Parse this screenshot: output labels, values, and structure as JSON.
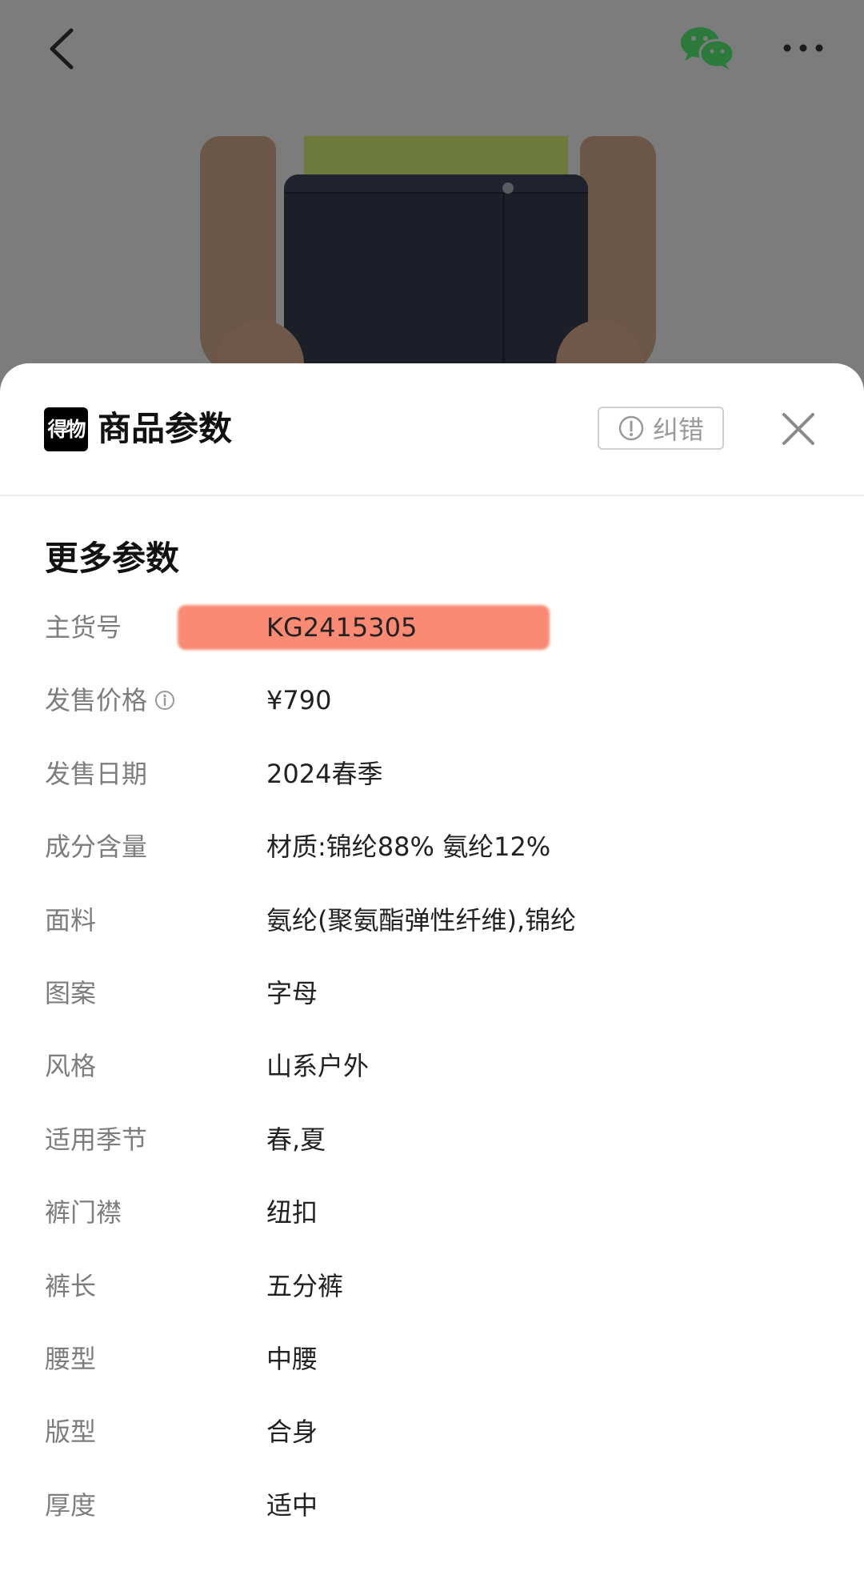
{
  "sheet": {
    "brand_logo_text": "得物",
    "title": "商品参数",
    "report_label": "纠错"
  },
  "section": {
    "title": "更多参数"
  },
  "params": [
    {
      "label": "主货号",
      "value": "KG2415305",
      "redacted": true
    },
    {
      "label": "发售价格",
      "value": "¥790",
      "info_icon": true
    },
    {
      "label": "发售日期",
      "value": "2024春季"
    },
    {
      "label": "成分含量",
      "value": "材质:锦纶88% 氨纶12%"
    },
    {
      "label": "面料",
      "value": "氨纶(聚氨酯弹性纤维),锦纶"
    },
    {
      "label": "图案",
      "value": "字母"
    },
    {
      "label": "风格",
      "value": "山系户外"
    },
    {
      "label": "适用季节",
      "value": "春,夏"
    },
    {
      "label": "裤门襟",
      "value": "纽扣"
    },
    {
      "label": "裤长",
      "value": "五分裤"
    },
    {
      "label": "腰型",
      "value": "中腰"
    },
    {
      "label": "版型",
      "value": "合身"
    },
    {
      "label": "厚度",
      "value": "适中"
    }
  ],
  "colors": {
    "redaction": "#fa8a74",
    "wechat_green": "#2b7a3b",
    "overlay": "#7b7b7b"
  },
  "icons": {
    "back": "chevron-left-icon",
    "share": "wechat-icon",
    "more": "more-dots-icon",
    "report": "exclamation-circle-icon",
    "close": "close-icon",
    "info": "info-icon"
  }
}
